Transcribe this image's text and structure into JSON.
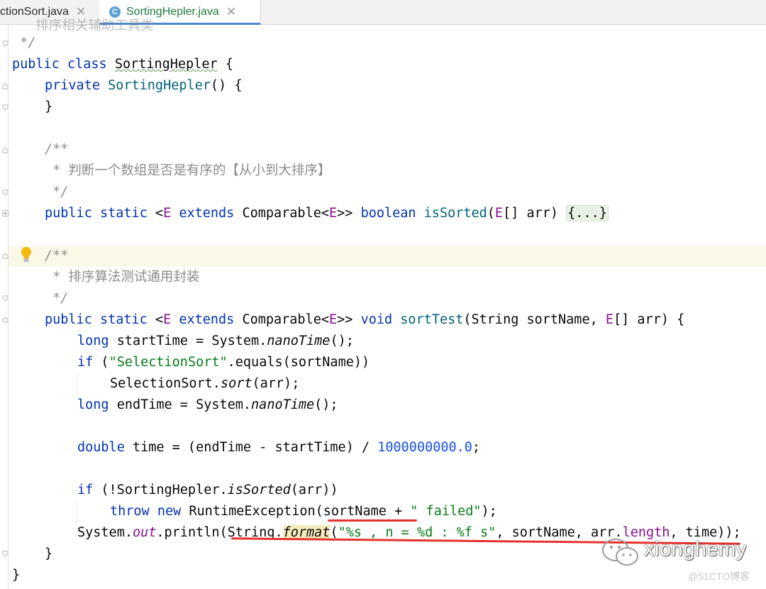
{
  "tabs": [
    {
      "label": "ctionSort.java",
      "close": "✕"
    },
    {
      "label": "SortingHepler.java",
      "icon_letter": "C",
      "close": "✕"
    }
  ],
  "code": {
    "l0_comment_partial": "   排序相关辅助工具类",
    "l1_comment_end": " */",
    "l2_public": "public",
    "l2_class": "class",
    "l2_name": "SortingHepler",
    "l2_brace": " {",
    "l3_private": "private",
    "l3_ctor": "SortingHepler",
    "l3_rest": "() {",
    "l4_close": "}",
    "l6_doc_start": "/**",
    "l7_doc": " * 判断一个数组是否是有序的【从小到大排序】",
    "l8_doc_end": " */",
    "l9_public": "public",
    "l9_static": "static",
    "l9_lt": " <",
    "l9_E1": "E",
    "l9_extends": "extends",
    "l9_comparable": "Comparable<",
    "l9_E2": "E",
    "l9_gt": ">>",
    "l9_boolean": "boolean",
    "l9_method": "isSorted",
    "l9_paren": "(",
    "l9_E3": "E",
    "l9_args": "[] arr) ",
    "l9_folded": "{...}",
    "l11_doc_start": "/**",
    "l12_doc": " * 排序算法测试通用封装",
    "l13_doc_end": " */",
    "l14_public": "public",
    "l14_static": "static",
    "l14_lt": " <",
    "l14_E1": "E",
    "l14_extends": "extends",
    "l14_comparable": "Comparable<",
    "l14_E2": "E",
    "l14_gt": ">>",
    "l14_void": "void",
    "l14_method": "sortTest",
    "l14_params1": "(String sortName, ",
    "l14_E3": "E",
    "l14_params2": "[] arr) {",
    "l15_long": "long",
    "l15_a": " startTime = System.",
    "l15_nano": "nanoTime",
    "l15_b": "();",
    "l16_if": "if",
    "l16_a": " (",
    "l16_str": "\"SelectionSort\"",
    "l16_b": ".equals(sortName))",
    "l17_a": "SelectionSort.",
    "l17_sort": "sort",
    "l17_b": "(arr);",
    "l18_long": "long",
    "l18_a": " endTime = System.",
    "l18_nano": "nanoTime",
    "l18_b": "();",
    "l20_double": "double",
    "l20_a": " time = (endTime - startTime) / ",
    "l20_num": "1000000000.0",
    "l20_b": ";",
    "l22_if": "if",
    "l22_a": " (!SortingHepler.",
    "l22_is": "isSorted",
    "l22_b": "(arr))",
    "l23_throw": "throw",
    "l23_new": "new",
    "l23_a": " RuntimeException(sortName + ",
    "l23_str": "\" failed\"",
    "l23_b": ");",
    "l24_a": "System.",
    "l24_out": "out",
    "l24_b": ".println(String.",
    "l24_format": "format",
    "l24_c": "(",
    "l24_str": "\"%s , n = %d : %f s\"",
    "l24_d": ", sortName, arr.",
    "l24_len": "length",
    "l24_e": ", time));",
    "l25_close": "}",
    "l26_close": "}"
  },
  "watermark": {
    "name": "xionghemy",
    "site": "@51CTO博客"
  },
  "colors": {
    "keyword": "#0033b3",
    "method": "#00627a",
    "string": "#067d17",
    "number": "#1750eb",
    "comment": "#8c8c8c",
    "field": "#871094",
    "annotation_red": "#e5322d"
  }
}
